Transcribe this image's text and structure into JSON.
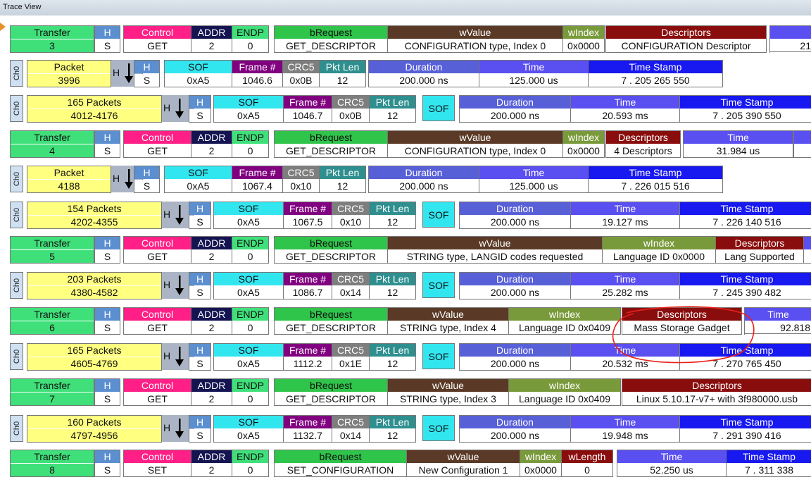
{
  "window": {
    "title": "Trace View"
  },
  "colors": {
    "transfer": "#3fe07a",
    "hs": "#5b8fd0",
    "control": "#ff1f86",
    "addr": "#141452",
    "endp": "#3fe07a",
    "brequest": "#2fc44a",
    "wvalue": "#5a3a26",
    "windex": "#799a3a",
    "descriptors": "#8a0d0d",
    "time": "#5a4ff0",
    "timestamp": "#1818f0",
    "packet": "#ffff80",
    "sof": "#32e6f0",
    "frame": "#800080",
    "crc5": "#7e7e7e",
    "pktlen": "#2f8f8f",
    "duration": "#5860d8",
    "wlength": "#8a0d0d",
    "annotation": "#e8201a"
  },
  "rows": [
    {
      "kind": "transfer",
      "id": "transfer-3",
      "blocks": [
        {
          "h": "Transfer",
          "v": "3"
        },
        {
          "h": "H",
          "v": "S"
        },
        {
          "h": "Control",
          "v": "GET"
        },
        {
          "h": "ADDR",
          "v": "2"
        },
        {
          "h": "ENDP",
          "v": "0"
        },
        {
          "h": "bRequest",
          "v": "GET_DESCRIPTOR"
        },
        {
          "h": "wValue",
          "v": "CONFIGURATION type, Index 0"
        },
        {
          "h": "wIndex",
          "v": "0x0000"
        },
        {
          "h": "Descriptors",
          "v": "CONFIGURATION Descriptor"
        },
        {
          "h": "",
          "v": "21"
        }
      ]
    },
    {
      "kind": "packet",
      "id": "packet-3996",
      "tag": "Ch0",
      "dir": "H",
      "blocks": [
        {
          "h": "Packet",
          "v": "3996"
        },
        {
          "h": "H",
          "v": "S"
        },
        {
          "h": "SOF",
          "v": "0xA5"
        },
        {
          "h": "Frame #",
          "v": "1046.6"
        },
        {
          "h": "CRC5",
          "v": "0x0B"
        },
        {
          "h": "Pkt Len",
          "v": "12"
        },
        {
          "h": "Duration",
          "v": "200.000 ns"
        },
        {
          "h": "Time",
          "v": "125.000 us"
        },
        {
          "h": "Time Stamp",
          "v": "7 . 205 265 550"
        }
      ]
    },
    {
      "kind": "group",
      "id": "group-4012",
      "tag": "Ch0",
      "dir": "H",
      "sof": "SOF",
      "blocks": [
        {
          "h": "165 Packets",
          "v": "4012-4176"
        },
        {
          "h": "H",
          "v": "S"
        },
        {
          "h": "SOF",
          "v": "0xA5"
        },
        {
          "h": "Frame #",
          "v": "1046.7"
        },
        {
          "h": "CRC5",
          "v": "0x0B"
        },
        {
          "h": "Pkt Len",
          "v": "12"
        },
        {
          "h": "Duration",
          "v": "200.000 ns"
        },
        {
          "h": "Time",
          "v": "20.593 ms"
        },
        {
          "h": "Time Stamp",
          "v": "7 . 205 390 550"
        }
      ]
    },
    {
      "kind": "transfer",
      "id": "transfer-4",
      "blocks": [
        {
          "h": "Transfer",
          "v": "4"
        },
        {
          "h": "H",
          "v": "S"
        },
        {
          "h": "Control",
          "v": "GET"
        },
        {
          "h": "ADDR",
          "v": "2"
        },
        {
          "h": "ENDP",
          "v": "0"
        },
        {
          "h": "bRequest",
          "v": "GET_DESCRIPTOR"
        },
        {
          "h": "wValue",
          "v": "CONFIGURATION type, Index 0"
        },
        {
          "h": "wIndex",
          "v": "0x0000"
        },
        {
          "h": "Descriptors",
          "v": "4 Descriptors"
        },
        {
          "h": "Time",
          "v": "31.984 us"
        },
        {
          "h": "",
          "v": ""
        }
      ]
    },
    {
      "kind": "packet",
      "id": "packet-4188",
      "tag": "Ch0",
      "dir": "H",
      "blocks": [
        {
          "h": "Packet",
          "v": "4188"
        },
        {
          "h": "H",
          "v": "S"
        },
        {
          "h": "SOF",
          "v": "0xA5"
        },
        {
          "h": "Frame #",
          "v": "1067.4"
        },
        {
          "h": "CRC5",
          "v": "0x10"
        },
        {
          "h": "Pkt Len",
          "v": "12"
        },
        {
          "h": "Duration",
          "v": "200.000 ns"
        },
        {
          "h": "Time",
          "v": "125.000 us"
        },
        {
          "h": "Time Stamp",
          "v": "7 . 226 015 516"
        }
      ]
    },
    {
      "kind": "group",
      "id": "group-4202",
      "tag": "Ch0",
      "dir": "H",
      "sof": "SOF",
      "blocks": [
        {
          "h": "154 Packets",
          "v": "4202-4355"
        },
        {
          "h": "H",
          "v": "S"
        },
        {
          "h": "SOF",
          "v": "0xA5"
        },
        {
          "h": "Frame #",
          "v": "1067.5"
        },
        {
          "h": "CRC5",
          "v": "0x10"
        },
        {
          "h": "Pkt Len",
          "v": "12"
        },
        {
          "h": "Duration",
          "v": "200.000 ns"
        },
        {
          "h": "Time",
          "v": "19.127 ms"
        },
        {
          "h": "Time Stamp",
          "v": "7 . 226 140 516"
        }
      ]
    },
    {
      "kind": "transfer",
      "id": "transfer-5",
      "blocks": [
        {
          "h": "Transfer",
          "v": "5"
        },
        {
          "h": "H",
          "v": "S"
        },
        {
          "h": "Control",
          "v": "GET"
        },
        {
          "h": "ADDR",
          "v": "2"
        },
        {
          "h": "ENDP",
          "v": "0"
        },
        {
          "h": "bRequest",
          "v": "GET_DESCRIPTOR"
        },
        {
          "h": "wValue",
          "v": "STRING type, LANGID codes requested"
        },
        {
          "h": "wIndex",
          "v": "Language ID 0x0000"
        },
        {
          "h": "Descriptors",
          "v": "Lang Supported"
        },
        {
          "h": "",
          "v": ""
        }
      ]
    },
    {
      "kind": "group",
      "id": "group-4380",
      "tag": "Ch0",
      "dir": "H",
      "sof": "SOF",
      "blocks": [
        {
          "h": "203 Packets",
          "v": "4380-4582"
        },
        {
          "h": "H",
          "v": "S"
        },
        {
          "h": "SOF",
          "v": "0xA5"
        },
        {
          "h": "Frame #",
          "v": "1086.7"
        },
        {
          "h": "CRC5",
          "v": "0x14"
        },
        {
          "h": "Pkt Len",
          "v": "12"
        },
        {
          "h": "Duration",
          "v": "200.000 ns"
        },
        {
          "h": "Time",
          "v": "25.282 ms"
        },
        {
          "h": "Time Stamp",
          "v": "7 . 245 390 482"
        }
      ]
    },
    {
      "kind": "transfer",
      "id": "transfer-6",
      "blocks": [
        {
          "h": "Transfer",
          "v": "6"
        },
        {
          "h": "H",
          "v": "S"
        },
        {
          "h": "Control",
          "v": "GET"
        },
        {
          "h": "ADDR",
          "v": "2"
        },
        {
          "h": "ENDP",
          "v": "0"
        },
        {
          "h": "bRequest",
          "v": "GET_DESCRIPTOR"
        },
        {
          "h": "wValue",
          "v": "STRING type, Index 4"
        },
        {
          "h": "wIndex",
          "v": "Language ID 0x0409"
        },
        {
          "h": "Descriptors",
          "v": "Mass Storage Gadget"
        },
        {
          "h": "Time",
          "v": "92.818"
        }
      ]
    },
    {
      "kind": "group",
      "id": "group-4605",
      "tag": "Ch0",
      "dir": "H",
      "sof": "SOF",
      "blocks": [
        {
          "h": "165 Packets",
          "v": "4605-4769"
        },
        {
          "h": "H",
          "v": "S"
        },
        {
          "h": "SOF",
          "v": "0xA5"
        },
        {
          "h": "Frame #",
          "v": "1112.2"
        },
        {
          "h": "CRC5",
          "v": "0x1E"
        },
        {
          "h": "Pkt Len",
          "v": "12"
        },
        {
          "h": "Duration",
          "v": "200.000 ns"
        },
        {
          "h": "Time",
          "v": "20.532 ms"
        },
        {
          "h": "Time Stamp",
          "v": "7 . 270 765 450"
        }
      ]
    },
    {
      "kind": "transfer",
      "id": "transfer-7",
      "blocks": [
        {
          "h": "Transfer",
          "v": "7"
        },
        {
          "h": "H",
          "v": "S"
        },
        {
          "h": "Control",
          "v": "GET"
        },
        {
          "h": "ADDR",
          "v": "2"
        },
        {
          "h": "ENDP",
          "v": "0"
        },
        {
          "h": "bRequest",
          "v": "GET_DESCRIPTOR"
        },
        {
          "h": "wValue",
          "v": "STRING type, Index 3"
        },
        {
          "h": "wIndex",
          "v": "Language ID 0x0409"
        },
        {
          "h": "Descriptors",
          "v": "Linux 5.10.17-v7+ with 3f980000.usb"
        }
      ]
    },
    {
      "kind": "group",
      "id": "group-4797",
      "tag": "Ch0",
      "dir": "H",
      "sof": "SOF",
      "blocks": [
        {
          "h": "160 Packets",
          "v": "4797-4956"
        },
        {
          "h": "H",
          "v": "S"
        },
        {
          "h": "SOF",
          "v": "0xA5"
        },
        {
          "h": "Frame #",
          "v": "1132.7"
        },
        {
          "h": "CRC5",
          "v": "0x14"
        },
        {
          "h": "Pkt Len",
          "v": "12"
        },
        {
          "h": "Duration",
          "v": "200.000 ns"
        },
        {
          "h": "Time",
          "v": "19.948 ms"
        },
        {
          "h": "Time Stamp",
          "v": "7 . 291 390 416"
        }
      ]
    },
    {
      "kind": "transfer",
      "id": "transfer-8",
      "blocks": [
        {
          "h": "Transfer",
          "v": "8"
        },
        {
          "h": "H",
          "v": "S"
        },
        {
          "h": "Control",
          "v": "SET"
        },
        {
          "h": "ADDR",
          "v": "2"
        },
        {
          "h": "ENDP",
          "v": "0"
        },
        {
          "h": "bRequest",
          "v": "SET_CONFIGURATION"
        },
        {
          "h": "wValue",
          "v": "New Configuration 1"
        },
        {
          "h": "wIndex",
          "v": "0x0000"
        },
        {
          "h": "wLength",
          "v": "0"
        },
        {
          "h": "Time",
          "v": "52.250 us"
        },
        {
          "h": "Time Stamp",
          "v": "7 . 311 338"
        }
      ]
    }
  ]
}
